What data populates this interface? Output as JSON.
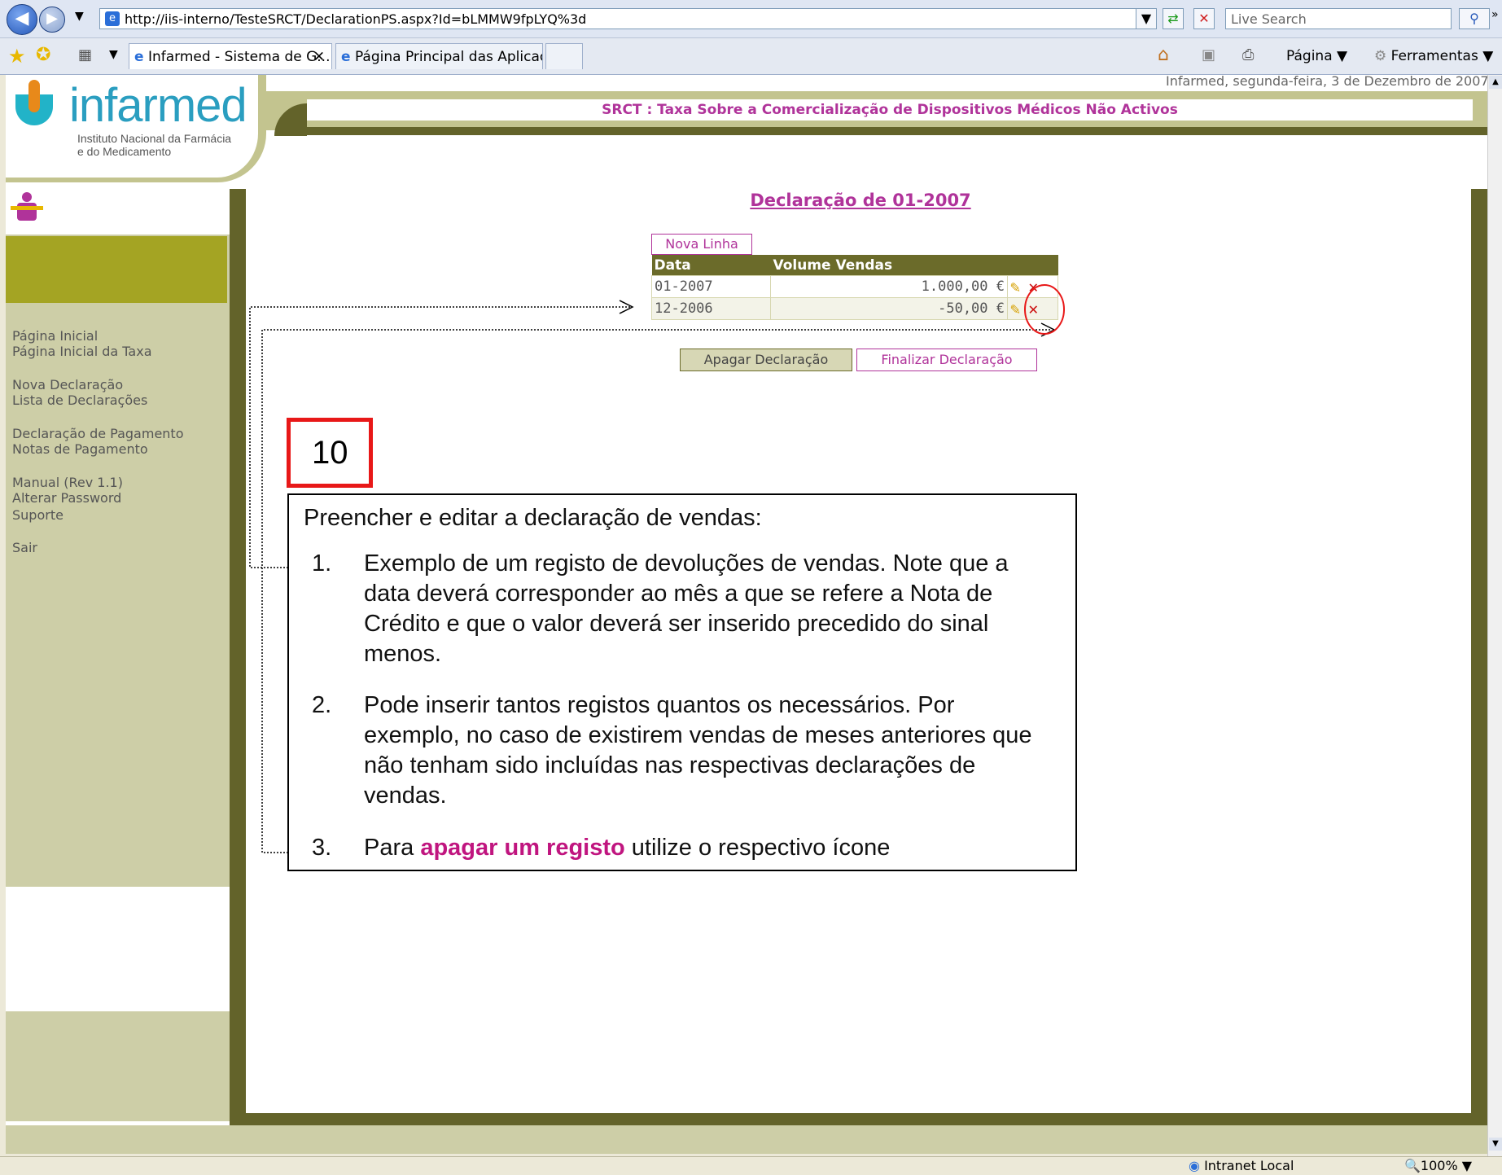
{
  "browser": {
    "url": "http://iis-interno/TesteSRCT/DeclarationPS.aspx?Id=bLMMW9fpLYQ%3d",
    "search_placeholder": "Live Search",
    "tabs": [
      {
        "label": "Infarmed - Sistema de G..."
      },
      {
        "label": "Página Principal das Aplicaçõ..."
      }
    ],
    "toolbar": {
      "page_label": "Página",
      "tools_label": "Ferramentas"
    },
    "status": {
      "zone": "Intranet Local",
      "zoom": "100%"
    }
  },
  "header": {
    "logo_text": "infarmed",
    "logo_subtitle_1": "Instituto Nacional da Farmácia",
    "logo_subtitle_2": "e do Medicamento",
    "date_line": "Infarmed, segunda-feira, 3 de Dezembro de 2007",
    "title": "SRCT : Taxa Sobre a Comercialização de Dispositivos Médicos Não Activos"
  },
  "sidebar": {
    "links": [
      "Página Inicial",
      "Página Inicial da Taxa",
      "Nova Declaração",
      "Lista de Declarações",
      "Declaração de Pagamento",
      "Notas de Pagamento",
      "Manual (Rev 1.1)",
      "Alterar Password",
      "Suporte",
      "Sair"
    ]
  },
  "main": {
    "heading": "Declaração de 01-2007",
    "new_line_button": "Nova Linha",
    "table": {
      "headers": [
        "Data",
        "Volume Vendas"
      ],
      "rows": [
        {
          "date": "01-2007",
          "volume": "1.000,00 €"
        },
        {
          "date": "12-2006",
          "volume": "-50,00 €"
        }
      ]
    },
    "delete_button": "Apagar Declaração",
    "finalize_button": "Finalizar Declaração"
  },
  "callout": {
    "number": "10",
    "intro": "Preencher e editar a declaração de vendas:",
    "items": [
      {
        "num": "1.",
        "text": "Exemplo de um registo de devoluções de vendas. Note que a data deverá corresponder ao mês a que se refere a Nota de Crédito e que o valor deverá ser inserido precedido do sinal menos."
      },
      {
        "num": "2.",
        "text": "Pode inserir tantos registos quantos os necessários. Por exemplo, no caso de existirem vendas de meses anteriores que não tenham sido incluídas nas respectivas declarações de vendas."
      },
      {
        "num": "3.",
        "text_before": "Para ",
        "highlight": "apagar um registo",
        "text_after": " utilize o respectivo ícone"
      }
    ],
    "highlight_color": "#c0157f"
  },
  "colors": {
    "olive_dark": "#63632a",
    "olive_light": "#cdcea7",
    "olive_mid": "#a4a423",
    "pink": "#b0339a"
  }
}
